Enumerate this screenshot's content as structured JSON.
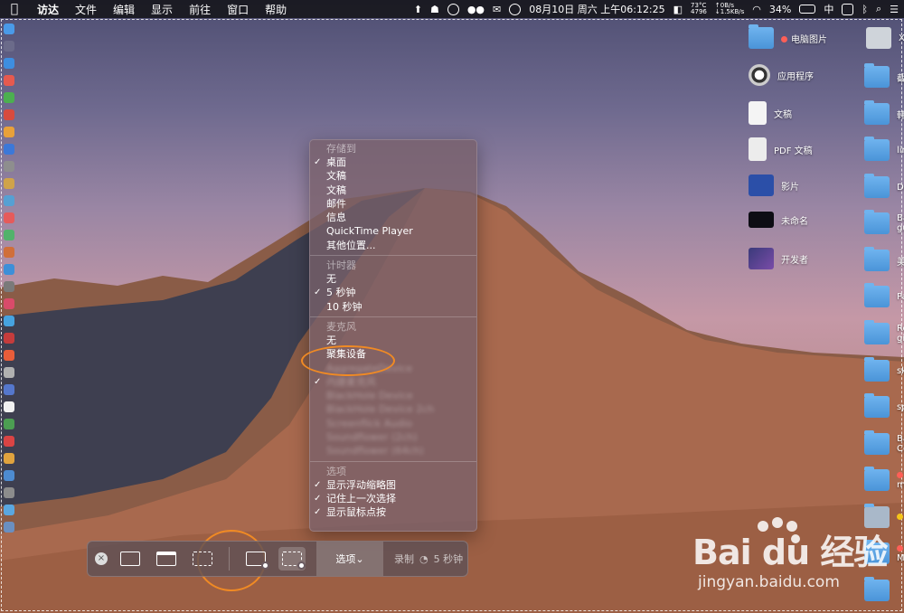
{
  "menubar": {
    "apple": "",
    "items": [
      "访达",
      "文件",
      "编辑",
      "显示",
      "前往",
      "窗口",
      "帮助"
    ],
    "temp": "73°C",
    "fan": "4796",
    "net_up": "0B/s",
    "net_down": "1.5KB/s",
    "datetime": "08月10日 周六 上午06:12:25",
    "battery": "34%",
    "input_method": "中"
  },
  "desktop_icons": [
    {
      "label": "电脑图片",
      "kind": "folder",
      "dot": "red"
    },
    {
      "label": "应用程序",
      "kind": "app"
    },
    {
      "label": "文稿",
      "kind": "doc"
    },
    {
      "label": "PDF 文稿",
      "kind": "doc"
    },
    {
      "label": "影片",
      "kind": "app"
    },
    {
      "label": "未命名",
      "kind": "dark"
    },
    {
      "label": "开发者",
      "kind": "app"
    }
  ],
  "desktop_icons_right": [
    {
      "label": "X"
    },
    {
      "label": "截"
    },
    {
      "label": "韩"
    },
    {
      "label": "lin"
    },
    {
      "label": "Do"
    },
    {
      "label": "Ba gu"
    },
    {
      "label": "美"
    },
    {
      "label": "Pa"
    },
    {
      "label": "Re gi"
    },
    {
      "label": "sk"
    },
    {
      "label": "sp"
    },
    {
      "label": "Ba Co"
    },
    {
      "label": "m"
    },
    {
      "label": ""
    },
    {
      "label": "M"
    },
    {
      "label": ""
    }
  ],
  "popup": {
    "save_to_header": "存储到",
    "save_to": [
      {
        "label": "桌面",
        "checked": true
      },
      {
        "label": "文稿",
        "checked": false
      },
      {
        "label": "文稿",
        "checked": false
      },
      {
        "label": "邮件",
        "checked": false
      },
      {
        "label": "信息",
        "checked": false
      },
      {
        "label": "QuickTime Player",
        "checked": false
      },
      {
        "label": "其他位置...",
        "checked": false
      }
    ],
    "timer_header": "计时器",
    "timer": [
      {
        "label": "无",
        "checked": false
      },
      {
        "label": "5 秒钟",
        "checked": true
      },
      {
        "label": "10 秒钟",
        "checked": false
      }
    ],
    "mic_header": "麦克风",
    "mic": [
      {
        "label": "无",
        "checked": false
      },
      {
        "label": "聚集设备",
        "checked": false
      }
    ],
    "mic_blurred": [
      {
        "label": "AggregateDevice",
        "checked": false
      },
      {
        "label": "内建麦克风",
        "checked": true
      },
      {
        "label": "BlackHole Device",
        "checked": false
      },
      {
        "label": "BlackHole Device 2ch",
        "checked": false
      },
      {
        "label": "Screenflick Audio",
        "checked": false
      },
      {
        "label": "Soundflower (2ch)",
        "checked": false
      },
      {
        "label": "Soundflower (64ch)",
        "checked": false
      }
    ],
    "options_header": "选项",
    "options": [
      {
        "label": "显示浮动缩略图",
        "checked": true
      },
      {
        "label": "记住上一次选择",
        "checked": true
      },
      {
        "label": "显示鼠标点按",
        "checked": true
      }
    ]
  },
  "toolbar": {
    "close": "×",
    "options_label": "选项⌄",
    "record_label": "录制",
    "record_timer": "5 秒钟"
  },
  "watermark": {
    "logo": "Bai du 经验",
    "url": "jingyan.baidu.com"
  }
}
